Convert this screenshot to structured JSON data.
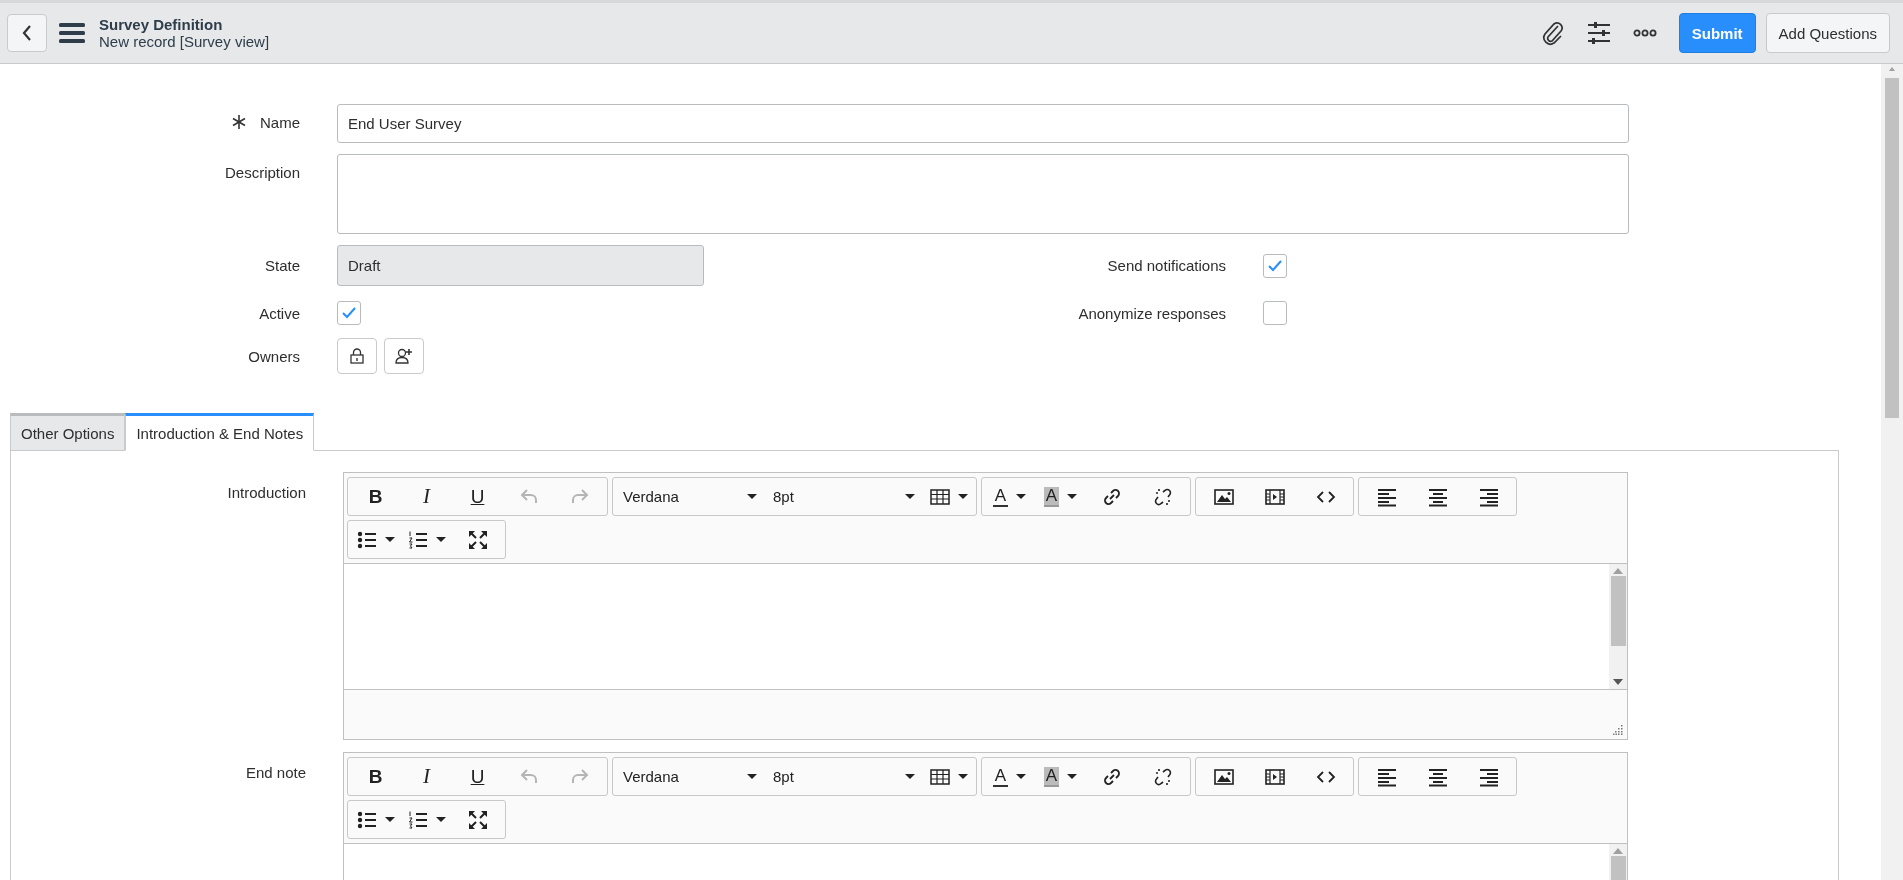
{
  "header": {
    "title": "Survey Definition",
    "subtitle": "New record [Survey view]",
    "buttons": [
      {
        "label": "Submit",
        "primary": true
      },
      {
        "label": "Add Questions",
        "primary": false
      }
    ]
  },
  "form": {
    "name": {
      "label": "Name",
      "value": "End User Survey",
      "required": true
    },
    "description": {
      "label": "Description"
    },
    "state": {
      "label": "State",
      "value": "Draft",
      "readonly": true
    },
    "send_notifications": {
      "label": "Send notifications",
      "checked": true
    },
    "active": {
      "label": "Active",
      "checked": true
    },
    "anonymize_responses": {
      "label": "Anonymize responses",
      "checked": false
    },
    "owners": {
      "label": "Owners"
    }
  },
  "tabs": [
    {
      "label": "Other Options",
      "selected": false
    },
    {
      "label": "Introduction & End Notes",
      "selected": true
    }
  ],
  "editors": [
    {
      "label": "Introduction",
      "toolbar": [
        [
          [
            {
              "kind": "bold",
              "text": "B",
              "disabled": false
            },
            {
              "kind": "italic",
              "text": "I",
              "disabled": false
            },
            {
              "kind": "underline",
              "text": "U",
              "disabled": false
            },
            {
              "kind": "undo",
              "disabled": true
            },
            {
              "kind": "redo",
              "disabled": true
            }
          ],
          [
            {
              "kind": "font",
              "text": "Verdana",
              "disabled": false
            },
            {
              "kind": "size",
              "text": "8pt",
              "disabled": false
            },
            {
              "kind": "table",
              "disabled": false
            }
          ],
          [
            {
              "kind": "forecolor",
              "text": "A",
              "disabled": false
            },
            {
              "kind": "backcolor",
              "text": "A",
              "disabled": false
            },
            {
              "kind": "link",
              "disabled": false
            },
            {
              "kind": "unlink",
              "disabled": false
            }
          ],
          [
            {
              "kind": "image",
              "disabled": false
            },
            {
              "kind": "media",
              "disabled": false
            },
            {
              "kind": "code",
              "disabled": false
            }
          ],
          [
            {
              "kind": "alignleft",
              "disabled": false
            },
            {
              "kind": "aligncenter",
              "disabled": false
            },
            {
              "kind": "alignright",
              "disabled": false
            }
          ]
        ],
        [
          [
            {
              "kind": "bullist",
              "disabled": false
            },
            {
              "kind": "numlist",
              "disabled": false
            },
            {
              "kind": "fullscreen",
              "disabled": false
            }
          ]
        ]
      ]
    },
    {
      "label": "End note",
      "toolbar": [
        [
          [
            {
              "kind": "bold",
              "text": "B",
              "disabled": false
            },
            {
              "kind": "italic",
              "text": "I",
              "disabled": false
            },
            {
              "kind": "underline",
              "text": "U",
              "disabled": false
            },
            {
              "kind": "undo",
              "disabled": true
            },
            {
              "kind": "redo",
              "disabled": true
            }
          ],
          [
            {
              "kind": "font",
              "text": "Verdana",
              "disabled": false
            },
            {
              "kind": "size",
              "text": "8pt",
              "disabled": false
            },
            {
              "kind": "table",
              "disabled": false
            }
          ],
          [
            {
              "kind": "forecolor",
              "text": "A",
              "disabled": false
            },
            {
              "kind": "backcolor",
              "text": "A",
              "disabled": false
            },
            {
              "kind": "link",
              "disabled": false
            },
            {
              "kind": "unlink",
              "disabled": false
            }
          ],
          [
            {
              "kind": "image",
              "disabled": false
            },
            {
              "kind": "media",
              "disabled": false
            },
            {
              "kind": "code",
              "disabled": false
            }
          ],
          [
            {
              "kind": "alignleft",
              "disabled": false
            },
            {
              "kind": "aligncenter",
              "disabled": false
            },
            {
              "kind": "alignright",
              "disabled": false
            }
          ]
        ],
        [
          [
            {
              "kind": "bullist",
              "disabled": false
            },
            {
              "kind": "numlist",
              "disabled": false
            },
            {
              "kind": "fullscreen",
              "disabled": false
            }
          ]
        ]
      ]
    }
  ]
}
